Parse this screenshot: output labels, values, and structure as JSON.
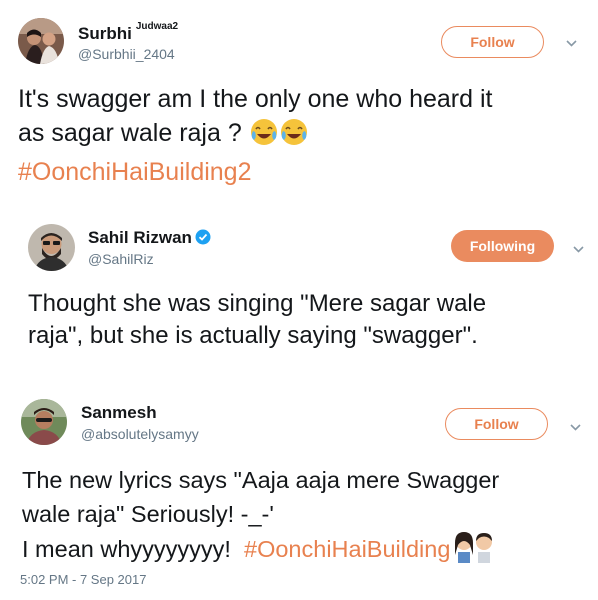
{
  "tweets": [
    {
      "name": "Surbhi",
      "name_suffix": "Judwaa2",
      "handle": "@Surbhii_2404",
      "button": "Follow",
      "text_line1": "It's swagger am I the only one who heard it",
      "text_line2": "as sagar wale raja ?",
      "hashtag": "#OonchiHaiBuilding2"
    },
    {
      "name": "Sahil Rizwan",
      "handle": "@SahilRiz",
      "button": "Following",
      "text_line1": "Thought she was singing \"Mere sagar wale",
      "text_line2": "raja\", but she is actually saying \"swagger\"."
    },
    {
      "name": "Sanmesh",
      "handle": "@absolutelysamyy",
      "button": "Follow",
      "text_line1": "The new lyrics says \"Aaja aaja mere Swagger",
      "text_line2": "wale raja\" Seriously! -_-'",
      "text_line3": "I mean whyyyyyyyy!",
      "hashtag": "#OonchiHaiBuilding",
      "timestamp": "5:02 PM - 7 Sep 2017"
    }
  ],
  "icons": {
    "chevron": "chevron-down-icon",
    "verified": "verified-badge-icon",
    "emoji": "face-with-tears-of-joy-icon",
    "couple": "couple-emoji-icon"
  },
  "colors": {
    "accent": "#e8814f",
    "secondary_text": "#657786"
  }
}
